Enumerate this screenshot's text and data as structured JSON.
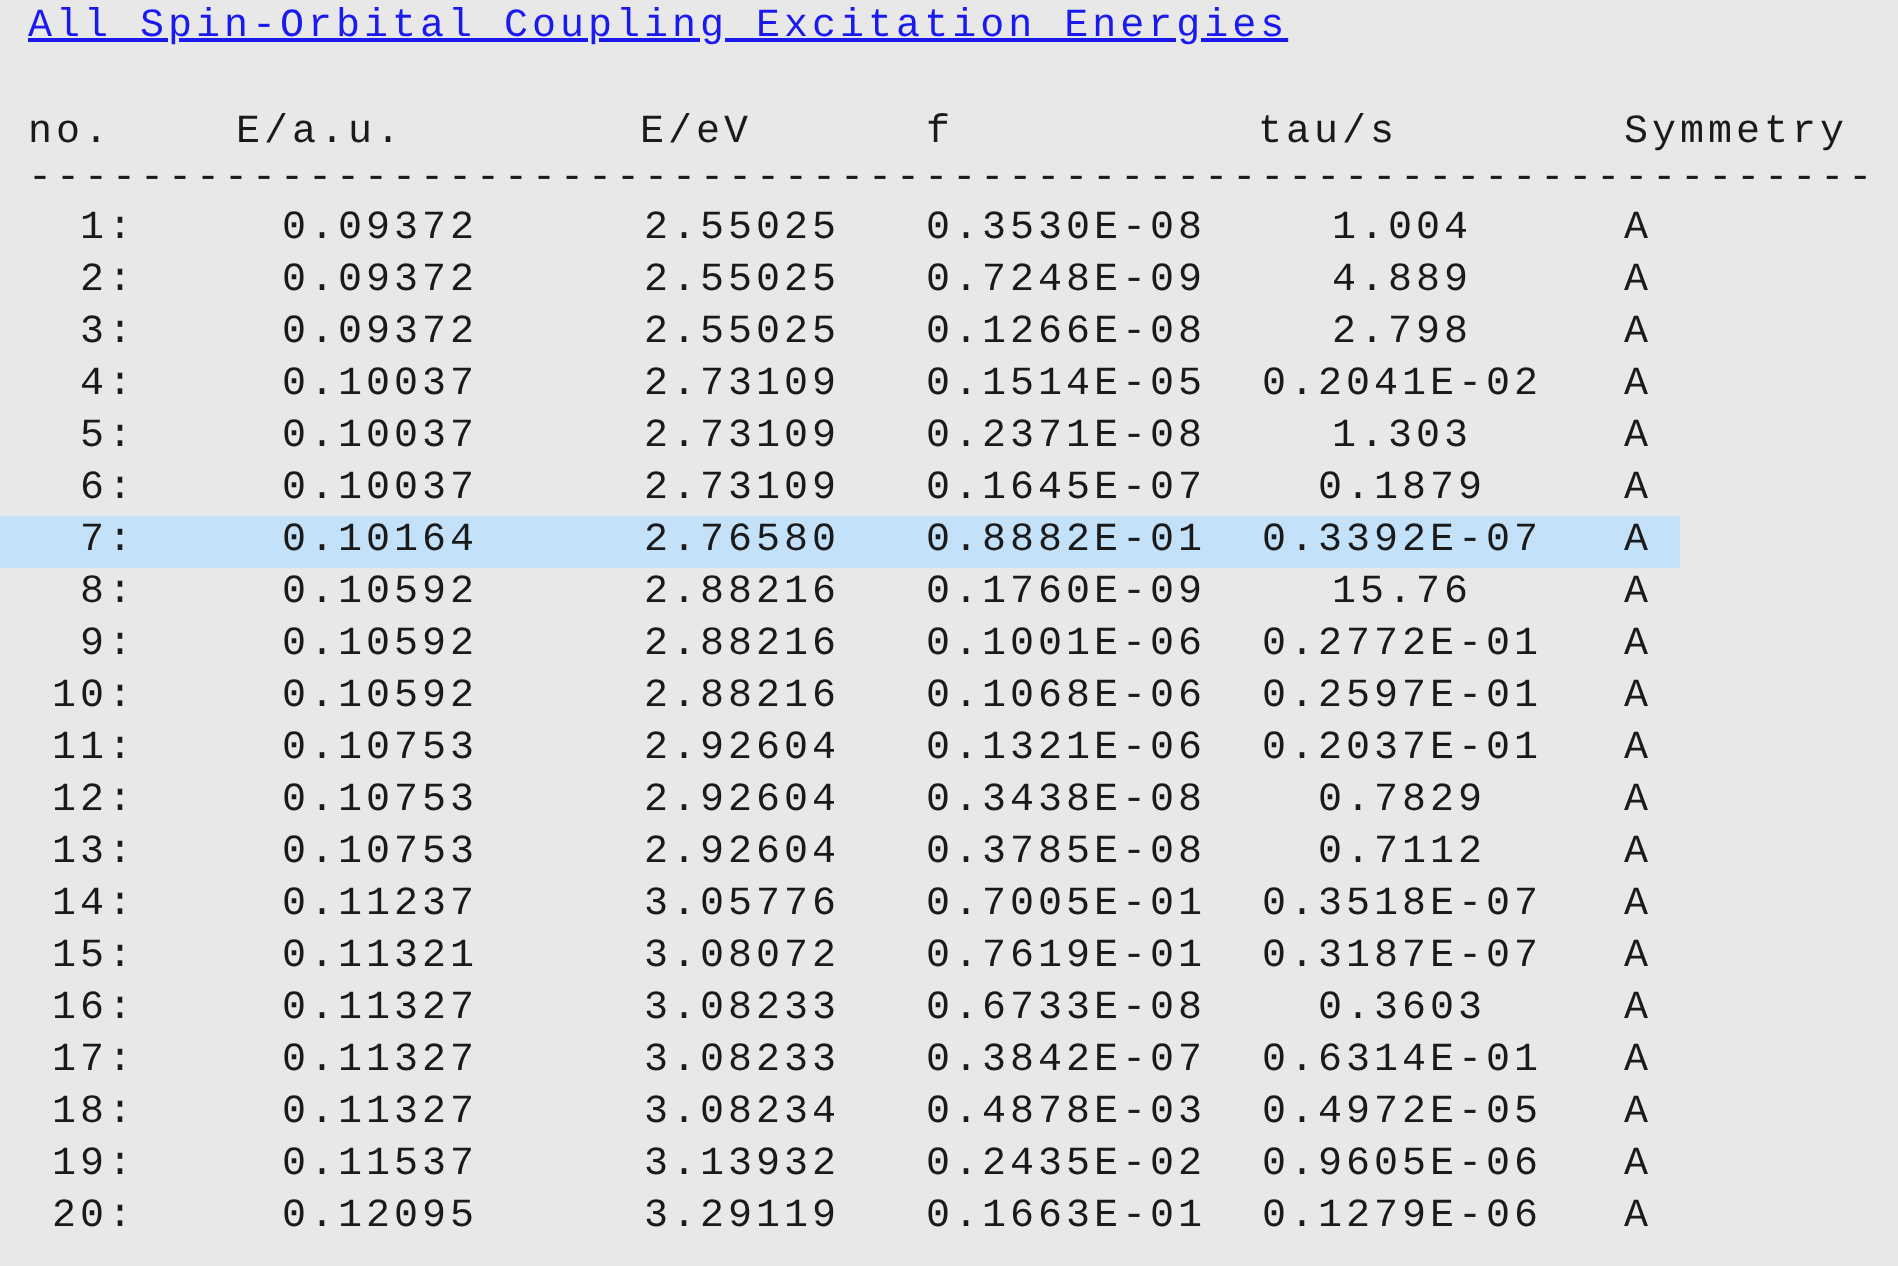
{
  "title_link": "All Spin-Orbital Coupling Excitation Energies",
  "table": {
    "columns": [
      "no.",
      "E/a.u.",
      "E/eV",
      "f",
      "tau/s",
      "Symmetry"
    ],
    "separator": "------------------------------------------------------------------",
    "rows": [
      {
        "no": "1:",
        "e_au": "0.09372",
        "e_ev": "2.55025",
        "f": "0.3530E-08",
        "tau": "1.004",
        "symmetry": "A",
        "selected": false
      },
      {
        "no": "2:",
        "e_au": "0.09372",
        "e_ev": "2.55025",
        "f": "0.7248E-09",
        "tau": "4.889",
        "symmetry": "A",
        "selected": false
      },
      {
        "no": "3:",
        "e_au": "0.09372",
        "e_ev": "2.55025",
        "f": "0.1266E-08",
        "tau": "2.798",
        "symmetry": "A",
        "selected": false
      },
      {
        "no": "4:",
        "e_au": "0.10037",
        "e_ev": "2.73109",
        "f": "0.1514E-05",
        "tau": "0.2041E-02",
        "symmetry": "A",
        "selected": false
      },
      {
        "no": "5:",
        "e_au": "0.10037",
        "e_ev": "2.73109",
        "f": "0.2371E-08",
        "tau": "1.303",
        "symmetry": "A",
        "selected": false
      },
      {
        "no": "6:",
        "e_au": "0.10037",
        "e_ev": "2.73109",
        "f": "0.1645E-07",
        "tau": "0.1879",
        "symmetry": "A",
        "selected": false
      },
      {
        "no": "7:",
        "e_au": "0.10164",
        "e_ev": "2.76580",
        "f": "0.8882E-01",
        "tau": "0.3392E-07",
        "symmetry": "A",
        "selected": true
      },
      {
        "no": "8:",
        "e_au": "0.10592",
        "e_ev": "2.88216",
        "f": "0.1760E-09",
        "tau": "15.76",
        "symmetry": "A",
        "selected": false
      },
      {
        "no": "9:",
        "e_au": "0.10592",
        "e_ev": "2.88216",
        "f": "0.1001E-06",
        "tau": "0.2772E-01",
        "symmetry": "A",
        "selected": false
      },
      {
        "no": "10:",
        "e_au": "0.10592",
        "e_ev": "2.88216",
        "f": "0.1068E-06",
        "tau": "0.2597E-01",
        "symmetry": "A",
        "selected": false
      },
      {
        "no": "11:",
        "e_au": "0.10753",
        "e_ev": "2.92604",
        "f": "0.1321E-06",
        "tau": "0.2037E-01",
        "symmetry": "A",
        "selected": false
      },
      {
        "no": "12:",
        "e_au": "0.10753",
        "e_ev": "2.92604",
        "f": "0.3438E-08",
        "tau": "0.7829",
        "symmetry": "A",
        "selected": false
      },
      {
        "no": "13:",
        "e_au": "0.10753",
        "e_ev": "2.92604",
        "f": "0.3785E-08",
        "tau": "0.7112",
        "symmetry": "A",
        "selected": false
      },
      {
        "no": "14:",
        "e_au": "0.11237",
        "e_ev": "3.05776",
        "f": "0.7005E-01",
        "tau": "0.3518E-07",
        "symmetry": "A",
        "selected": false
      },
      {
        "no": "15:",
        "e_au": "0.11321",
        "e_ev": "3.08072",
        "f": "0.7619E-01",
        "tau": "0.3187E-07",
        "symmetry": "A",
        "selected": false
      },
      {
        "no": "16:",
        "e_au": "0.11327",
        "e_ev": "3.08233",
        "f": "0.6733E-08",
        "tau": "0.3603",
        "symmetry": "A",
        "selected": false
      },
      {
        "no": "17:",
        "e_au": "0.11327",
        "e_ev": "3.08233",
        "f": "0.3842E-07",
        "tau": "0.6314E-01",
        "symmetry": "A",
        "selected": false
      },
      {
        "no": "18:",
        "e_au": "0.11327",
        "e_ev": "3.08234",
        "f": "0.4878E-03",
        "tau": "0.4972E-05",
        "symmetry": "A",
        "selected": false
      },
      {
        "no": "19:",
        "e_au": "0.11537",
        "e_ev": "3.13932",
        "f": "0.2435E-02",
        "tau": "0.9605E-06",
        "symmetry": "A",
        "selected": false
      },
      {
        "no": "20:",
        "e_au": "0.12095",
        "e_ev": "3.29119",
        "f": "0.1663E-01",
        "tau": "0.1279E-06",
        "symmetry": "A",
        "selected": false
      }
    ]
  }
}
